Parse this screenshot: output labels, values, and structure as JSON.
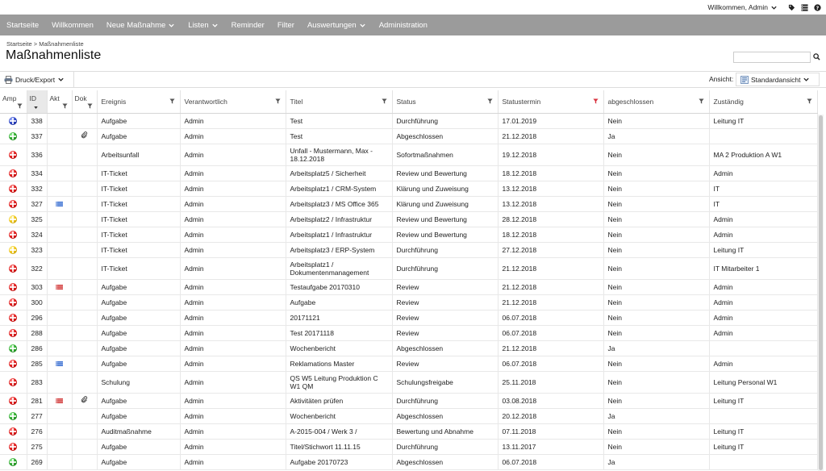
{
  "topbar": {
    "user_label": "Willkommen, Admin"
  },
  "nav": {
    "items": [
      {
        "label": "Startseite",
        "dropdown": false
      },
      {
        "label": "Willkommen",
        "dropdown": false
      },
      {
        "label": "Neue Maßnahme",
        "dropdown": true
      },
      {
        "label": "Listen",
        "dropdown": true
      },
      {
        "label": "Reminder",
        "dropdown": false
      },
      {
        "label": "Filter",
        "dropdown": false
      },
      {
        "label": "Auswertungen",
        "dropdown": true
      },
      {
        "label": "Administration",
        "dropdown": false
      }
    ]
  },
  "breadcrumb": "Startseite > Maßnahmenliste",
  "page_title": "Maßnahmenliste",
  "search": {
    "value": "",
    "placeholder": ""
  },
  "toolbar": {
    "print_label": "Druck/Export",
    "view_label": "Ansicht:",
    "view_value": "Standardansicht"
  },
  "columns": [
    {
      "key": "amp",
      "label": "Amp"
    },
    {
      "key": "id",
      "label": "ID"
    },
    {
      "key": "akt",
      "label": "Akt"
    },
    {
      "key": "dok",
      "label": "Dok"
    },
    {
      "key": "ereignis",
      "label": "Ereignis"
    },
    {
      "key": "verantwortlich",
      "label": "Verantwortlich"
    },
    {
      "key": "titel",
      "label": "Titel"
    },
    {
      "key": "status",
      "label": "Status"
    },
    {
      "key": "statustermin",
      "label": "Statustermin"
    },
    {
      "key": "abgeschlossen",
      "label": "abgeschlossen"
    },
    {
      "key": "zustaendig",
      "label": "Zuständig"
    }
  ],
  "colors": {
    "nav_bg": "#9b9b9b",
    "filter_active": "#d9333f"
  },
  "rows": [
    {
      "amp": "blue",
      "id": "338",
      "akt": "",
      "dok": "",
      "ereignis": "Aufgabe",
      "verantwortlich": "Admin",
      "titel": "Test",
      "status": "Durchführung",
      "statustermin": "17.01.2019",
      "abgeschlossen": "Nein",
      "zustaendig": "Leitung IT"
    },
    {
      "amp": "green",
      "id": "337",
      "akt": "",
      "dok": "paperclip",
      "ereignis": "Aufgabe",
      "verantwortlich": "Admin",
      "titel": "Test",
      "status": "Abgeschlossen",
      "statustermin": "21.12.2018",
      "abgeschlossen": "Ja",
      "zustaendig": ""
    },
    {
      "amp": "red",
      "id": "336",
      "akt": "",
      "dok": "",
      "ereignis": "Arbeitsunfall",
      "verantwortlich": "Admin",
      "titel": "Unfall - Mustermann, Max - 18.12.2018",
      "status": "Sofortmaßnahmen",
      "statustermin": "19.12.2018",
      "abgeschlossen": "Nein",
      "zustaendig": "MA 2 Produktion A W1"
    },
    {
      "amp": "red",
      "id": "334",
      "akt": "",
      "dok": "",
      "ereignis": "IT-Ticket",
      "verantwortlich": "Admin",
      "titel": "Arbeitsplatz5 / Sicherheit",
      "status": "Review und Bewertung",
      "statustermin": "18.12.2018",
      "abgeschlossen": "Nein",
      "zustaendig": "Admin"
    },
    {
      "amp": "red",
      "id": "332",
      "akt": "",
      "dok": "",
      "ereignis": "IT-Ticket",
      "verantwortlich": "Admin",
      "titel": "Arbeitsplatz1 / CRM-System",
      "status": "Klärung und Zuweisung",
      "statustermin": "13.12.2018",
      "abgeschlossen": "Nein",
      "zustaendig": "IT"
    },
    {
      "amp": "red",
      "id": "327",
      "akt": "blue",
      "dok": "",
      "ereignis": "IT-Ticket",
      "verantwortlich": "Admin",
      "titel": "Arbeitsplatz3 / MS Office 365",
      "status": "Klärung und Zuweisung",
      "statustermin": "13.12.2018",
      "abgeschlossen": "Nein",
      "zustaendig": "IT"
    },
    {
      "amp": "yellow",
      "id": "325",
      "akt": "",
      "dok": "",
      "ereignis": "IT-Ticket",
      "verantwortlich": "Admin",
      "titel": "Arbeitsplatz2 / Infrastruktur",
      "status": "Review und Bewertung",
      "statustermin": "28.12.2018",
      "abgeschlossen": "Nein",
      "zustaendig": "Admin"
    },
    {
      "amp": "red",
      "id": "324",
      "akt": "",
      "dok": "",
      "ereignis": "IT-Ticket",
      "verantwortlich": "Admin",
      "titel": "Arbeitsplatz1 / Infrastruktur",
      "status": "Review und Bewertung",
      "statustermin": "18.12.2018",
      "abgeschlossen": "Nein",
      "zustaendig": "Admin"
    },
    {
      "amp": "yellow",
      "id": "323",
      "akt": "",
      "dok": "",
      "ereignis": "IT-Ticket",
      "verantwortlich": "Admin",
      "titel": "Arbeitsplatz3 / ERP-System",
      "status": "Durchführung",
      "statustermin": "27.12.2018",
      "abgeschlossen": "Nein",
      "zustaendig": "Leitung IT"
    },
    {
      "amp": "red",
      "id": "322",
      "akt": "",
      "dok": "",
      "ereignis": "IT-Ticket",
      "verantwortlich": "Admin",
      "titel": "Arbeitsplatz1 / Dokumentenmanagement",
      "status": "Durchführung",
      "statustermin": "21.12.2018",
      "abgeschlossen": "Nein",
      "zustaendig": "IT Mitarbeiter 1"
    },
    {
      "amp": "red",
      "id": "303",
      "akt": "red",
      "dok": "",
      "ereignis": "Aufgabe",
      "verantwortlich": "Admin",
      "titel": "Testaufgabe 20170310",
      "status": "Review",
      "statustermin": "21.12.2018",
      "abgeschlossen": "Nein",
      "zustaendig": "Admin"
    },
    {
      "amp": "red",
      "id": "300",
      "akt": "",
      "dok": "",
      "ereignis": "Aufgabe",
      "verantwortlich": "Admin",
      "titel": "Aufgabe",
      "status": "Review",
      "statustermin": "21.12.2018",
      "abgeschlossen": "Nein",
      "zustaendig": "Admin"
    },
    {
      "amp": "red",
      "id": "296",
      "akt": "",
      "dok": "",
      "ereignis": "Aufgabe",
      "verantwortlich": "Admin",
      "titel": "20171121",
      "status": "Review",
      "statustermin": "06.07.2018",
      "abgeschlossen": "Nein",
      "zustaendig": "Admin"
    },
    {
      "amp": "red",
      "id": "288",
      "akt": "",
      "dok": "",
      "ereignis": "Aufgabe",
      "verantwortlich": "Admin",
      "titel": "Test 20171118",
      "status": "Review",
      "statustermin": "06.07.2018",
      "abgeschlossen": "Nein",
      "zustaendig": "Admin"
    },
    {
      "amp": "green",
      "id": "286",
      "akt": "",
      "dok": "",
      "ereignis": "Aufgabe",
      "verantwortlich": "Admin",
      "titel": "Wochenbericht",
      "status": "Abgeschlossen",
      "statustermin": "21.12.2018",
      "abgeschlossen": "Ja",
      "zustaendig": ""
    },
    {
      "amp": "red",
      "id": "285",
      "akt": "blue",
      "dok": "",
      "ereignis": "Aufgabe",
      "verantwortlich": "Admin",
      "titel": "Reklamations Master",
      "status": "Review",
      "statustermin": "06.07.2018",
      "abgeschlossen": "Nein",
      "zustaendig": "Admin"
    },
    {
      "amp": "red",
      "id": "283",
      "akt": "",
      "dok": "",
      "ereignis": "Schulung",
      "verantwortlich": "Admin",
      "titel": "QS W5 Leitung Produktion C W1 QM",
      "status": "Schulungsfreigabe",
      "statustermin": "25.11.2018",
      "abgeschlossen": "Nein",
      "zustaendig": "Leitung Personal W1"
    },
    {
      "amp": "red",
      "id": "281",
      "akt": "red",
      "dok": "paperclip",
      "ereignis": "Aufgabe",
      "verantwortlich": "Admin",
      "titel": "Aktivitäten prüfen",
      "status": "Durchführung",
      "statustermin": "03.08.2018",
      "abgeschlossen": "Nein",
      "zustaendig": "Leitung IT"
    },
    {
      "amp": "green",
      "id": "277",
      "akt": "",
      "dok": "",
      "ereignis": "Aufgabe",
      "verantwortlich": "Admin",
      "titel": "Wochenbericht",
      "status": "Abgeschlossen",
      "statustermin": "20.12.2018",
      "abgeschlossen": "Ja",
      "zustaendig": ""
    },
    {
      "amp": "red",
      "id": "276",
      "akt": "",
      "dok": "",
      "ereignis": "Auditmaßnahme",
      "verantwortlich": "Admin",
      "titel": "A-2015-004 / Werk 3 /",
      "status": "Bewertung und Abnahme",
      "statustermin": "07.11.2018",
      "abgeschlossen": "Nein",
      "zustaendig": "Leitung IT"
    },
    {
      "amp": "red",
      "id": "275",
      "akt": "",
      "dok": "",
      "ereignis": "Aufgabe",
      "verantwortlich": "Admin",
      "titel": "Titel/Stichwort 11.11.15",
      "status": "Durchführung",
      "statustermin": "13.11.2017",
      "abgeschlossen": "Nein",
      "zustaendig": "Leitung IT"
    },
    {
      "amp": "green",
      "id": "269",
      "akt": "",
      "dok": "",
      "ereignis": "Aufgabe",
      "verantwortlich": "Admin",
      "titel": "Aufgabe 20170723",
      "status": "Abgeschlossen",
      "statustermin": "06.07.2018",
      "abgeschlossen": "Ja",
      "zustaendig": ""
    }
  ]
}
